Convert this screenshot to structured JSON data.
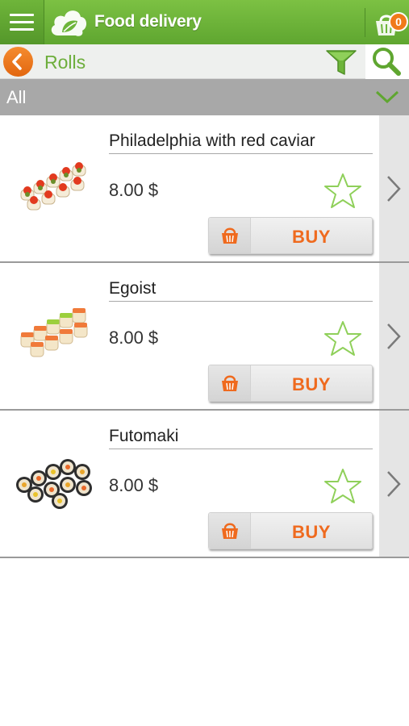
{
  "app_bar": {
    "title": "Food delivery",
    "cart_count": "0",
    "accent_color": "#6db53a",
    "cart_badge_color": "#f07a1a"
  },
  "sub_header": {
    "title": "Rolls"
  },
  "category": {
    "selected": "All"
  },
  "products": [
    {
      "name": "Philadelphia with red caviar",
      "price": "8.00 $",
      "buy_label": "BUY",
      "image": "philadelphia-roll-image"
    },
    {
      "name": "Egoist",
      "price": "8.00 $",
      "buy_label": "BUY",
      "image": "egoist-roll-image"
    },
    {
      "name": "Futomaki",
      "price": "8.00 $",
      "buy_label": "BUY",
      "image": "futomaki-roll-image"
    }
  ],
  "icons": [
    "menu-icon",
    "app-logo",
    "cart-icon",
    "back-icon",
    "filter-icon",
    "search-icon",
    "chevron-down-icon",
    "star-icon",
    "basket-icon",
    "chevron-right-icon"
  ]
}
